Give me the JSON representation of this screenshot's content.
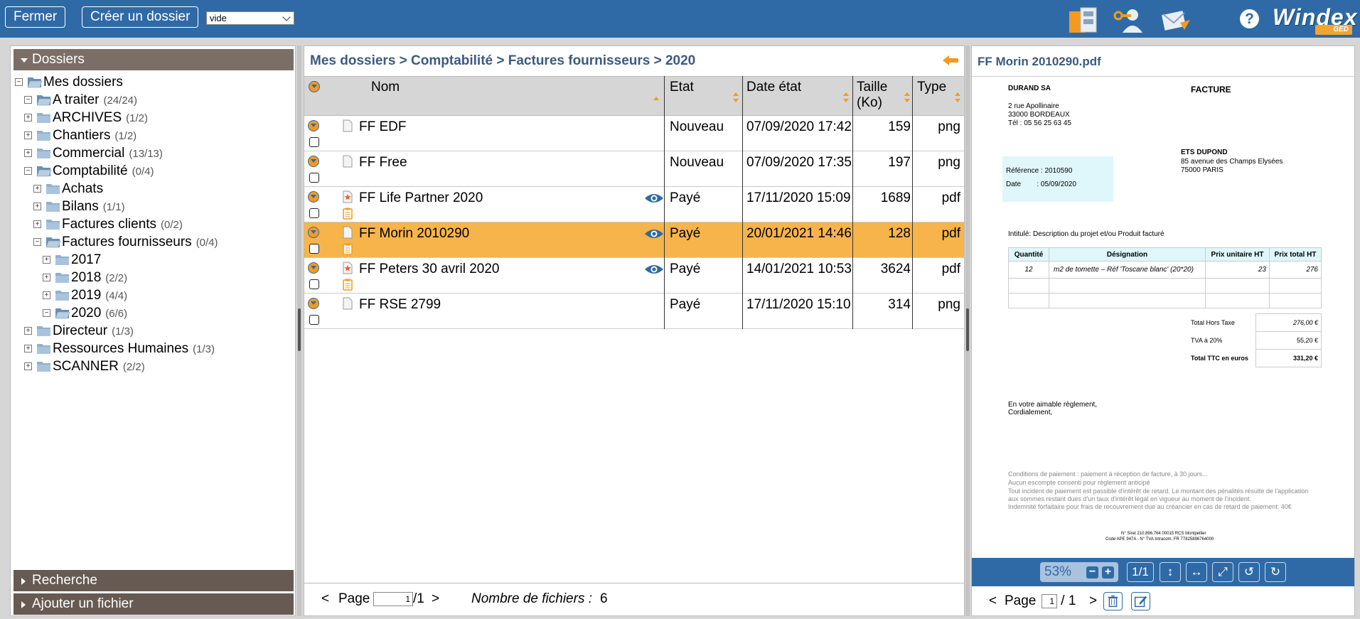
{
  "toolbar": {
    "close_label": "Fermer",
    "create_folder_label": "Créer un dossier",
    "template_select_value": "vide",
    "help_label": "?",
    "logo_text": "Windex",
    "logo_sub": "GED",
    "icons": [
      "archive-door-icon",
      "user-key-icon",
      "send-mail-icon",
      "help-icon"
    ]
  },
  "sidebar": {
    "header": "Dossiers",
    "tree": [
      {
        "label": "Mes dossiers",
        "count": "",
        "level": 0,
        "expanded": true,
        "open_folder": true
      },
      {
        "label": "A traiter",
        "count": "(24/24)",
        "level": 1,
        "expanded": true,
        "open_folder": true
      },
      {
        "label": "ARCHIVES",
        "count": "(1/2)",
        "level": 1,
        "expanded": false,
        "open_folder": false
      },
      {
        "label": "Chantiers",
        "count": "(1/2)",
        "level": 1,
        "expanded": false,
        "open_folder": false
      },
      {
        "label": "Commercial",
        "count": "(13/13)",
        "level": 1,
        "expanded": false,
        "open_folder": false
      },
      {
        "label": "Comptabilité",
        "count": "(0/4)",
        "level": 1,
        "expanded": true,
        "open_folder": true
      },
      {
        "label": "Achats",
        "count": "",
        "level": 2,
        "expanded": false,
        "open_folder": false
      },
      {
        "label": "Bilans",
        "count": "(1/1)",
        "level": 2,
        "expanded": false,
        "open_folder": false
      },
      {
        "label": "Factures clients",
        "count": "(0/2)",
        "level": 2,
        "expanded": false,
        "open_folder": false
      },
      {
        "label": "Factures fournisseurs",
        "count": "(0/4)",
        "level": 2,
        "expanded": true,
        "open_folder": true
      },
      {
        "label": "2017",
        "count": "",
        "level": 3,
        "expanded": false,
        "open_folder": false
      },
      {
        "label": "2018",
        "count": "(2/2)",
        "level": 3,
        "expanded": false,
        "open_folder": false
      },
      {
        "label": "2019",
        "count": "(4/4)",
        "level": 3,
        "expanded": false,
        "open_folder": false
      },
      {
        "label": "2020",
        "count": "(6/6)",
        "level": 3,
        "expanded": true,
        "open_folder": true
      },
      {
        "label": "Directeur",
        "count": "(1/3)",
        "level": 1,
        "expanded": false,
        "open_folder": false
      },
      {
        "label": "Ressources Humaines",
        "count": "(1/3)",
        "level": 1,
        "expanded": false,
        "open_folder": false
      },
      {
        "label": "SCANNER",
        "count": "(2/2)",
        "level": 1,
        "expanded": false,
        "open_folder": false
      }
    ],
    "search_label": "Recherche",
    "add_file_label": "Ajouter un fichier"
  },
  "main": {
    "breadcrumb": "Mes dossiers > Comptabilité > Factures fournisseurs > 2020",
    "columns": {
      "name": "Nom",
      "status": "Etat",
      "date": "Date état",
      "size": "Taille (Ko)",
      "type": "Type"
    },
    "rows": [
      {
        "name": "FF EDF",
        "status": "Nouveau",
        "date": "07/09/2020 17:42",
        "size": "159",
        "type": "png",
        "selected": false,
        "eye": false,
        "attachment": false,
        "starred": false
      },
      {
        "name": "FF Free",
        "status": "Nouveau",
        "date": "07/09/2020 17:35",
        "size": "197",
        "type": "png",
        "selected": false,
        "eye": false,
        "attachment": false,
        "starred": false
      },
      {
        "name": "FF Life Partner 2020",
        "status": "Payé",
        "date": "17/11/2020 15:09",
        "size": "1689",
        "type": "pdf",
        "selected": false,
        "eye": true,
        "attachment": true,
        "starred": true
      },
      {
        "name": "FF Morin 2010290",
        "status": "Payé",
        "date": "20/01/2021 14:46",
        "size": "128",
        "type": "pdf",
        "selected": true,
        "eye": true,
        "attachment": true,
        "starred": false
      },
      {
        "name": "FF Peters 30 avril 2020",
        "status": "Payé",
        "date": "14/01/2021 10:53",
        "size": "3624",
        "type": "pdf",
        "selected": false,
        "eye": true,
        "attachment": true,
        "starred": true
      },
      {
        "name": "FF RSE 2799",
        "status": "Payé",
        "date": "17/11/2020 15:10",
        "size": "314",
        "type": "png",
        "selected": false,
        "eye": false,
        "attachment": false,
        "starred": false
      }
    ],
    "pager": {
      "prev": "<",
      "label": "Page",
      "page": "1",
      "total": "/1",
      "next": ">",
      "count_label": "Nombre de fichiers :",
      "count": "6"
    }
  },
  "viewer": {
    "title": "FF Morin 2010290.pdf",
    "invoice": {
      "seller": "DURAND SA",
      "seller_addr1": "2 rue Apollinaire",
      "seller_addr2": "33000 BORDEAUX",
      "seller_tel": "Tél : 05 56 25 63 45",
      "doc_type": "FACTURE",
      "buyer": "ETS DUPOND",
      "buyer_addr1": "85 avenue des Champs Elysées",
      "buyer_addr2": "75000 PARIS",
      "ref": "Référence : 2010590",
      "date": "Date        : 05/09/2020",
      "intitule": "Intitulé: Description du projet et/ou Produit facturé",
      "th": [
        "Quantité",
        "Désignation",
        "Prix unitaire HT",
        "Prix total HT"
      ],
      "line": [
        "12",
        "m2 de tomette – Réf 'Toscane blanc' (20*20)",
        "23",
        "276"
      ],
      "total_ht_label": "Total Hors Taxe",
      "total_ht": "276,00 €",
      "tva_label": "TVA à 20%",
      "tva": "55,20 €",
      "ttc_label": "Total TTC en euros",
      "ttc": "331,20 €",
      "closing1": "En votre aimable règlement,",
      "closing2": "Cordialement,",
      "cond1": "Conditions de paiement : paiement à réception de facture, à 30 jours...",
      "cond2": "Aucun escompte consenti pour règlement anticipé",
      "cond3": "Tout incident de paiement est passible d'intérêt de retard. Le montant des pénalités résulte de l'application",
      "cond4": "aux sommes restant dues d'un taux d'intérêt légal en vigueur au moment de l'incident.",
      "cond5": "Indemnité forfaitaire pour frais de recouvrement due au créancier en cas de retard de paiement: 40€",
      "foot1": "N° Siret 210.896.764 00015 RCS Montpellier",
      "foot2": "Code APE 947A - N° TVA Intracom. FR 77825896764000"
    },
    "zoom": "53%",
    "page_indicator": "1/1",
    "pager": {
      "prev": "<",
      "label": "Page",
      "page": "1",
      "total": "/ 1",
      "next": ">"
    }
  }
}
